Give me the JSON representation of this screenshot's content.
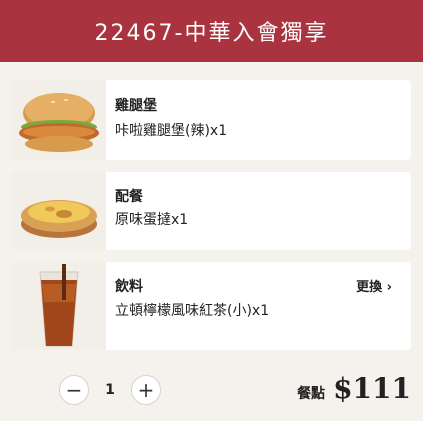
{
  "header": {
    "title": "22467-中華入會獨享"
  },
  "items": [
    {
      "title": "雞腿堡",
      "desc": "咔啦雞腿堡(辣)x1",
      "icon": "chicken-burger-image"
    },
    {
      "title": "配餐",
      "desc": "原味蛋撻x1",
      "icon": "egg-tart-image"
    },
    {
      "title": "飲料",
      "desc": "立頓檸檬風味紅茶(小)x1",
      "icon": "iced-tea-image",
      "change_label": "更換 ›"
    }
  ],
  "quantity": {
    "minus": "−",
    "value": "1",
    "plus": "+"
  },
  "price": {
    "label": "餐點",
    "value": "$111"
  }
}
